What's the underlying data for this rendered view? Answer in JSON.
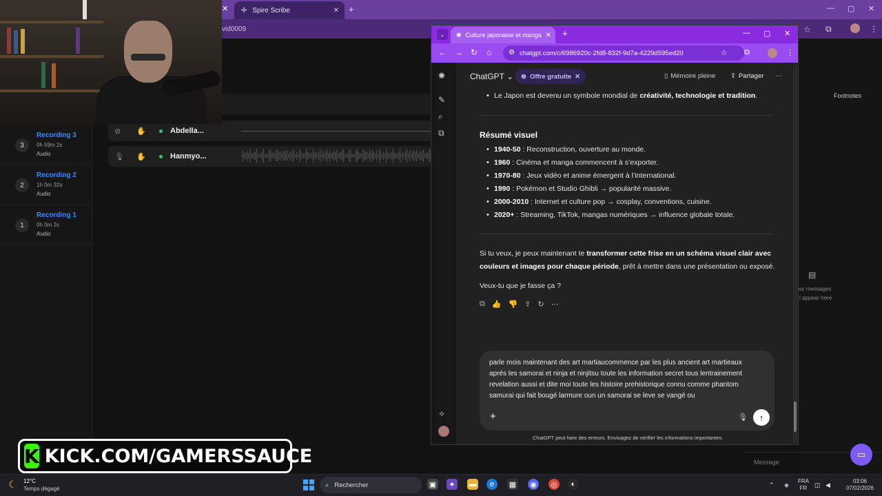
{
  "background_browser": {
    "tab_title": "Spire Scribe",
    "address_fragment": "vid0009"
  },
  "scribe": {
    "recordings": [
      {
        "num": "3",
        "title": "Recording 3",
        "duration": "0h 59m 2s",
        "type": "Audio"
      },
      {
        "num": "2",
        "title": "Recording 2",
        "duration": "1h 0m 32s",
        "type": "Audio"
      },
      {
        "num": "1",
        "title": "Recording 1",
        "duration": "0h 0m 2s",
        "type": "Audio"
      }
    ],
    "tracks": [
      {
        "name": "Abdella..."
      },
      {
        "name": "Hanmyo..."
      }
    ],
    "right_panel": {
      "footnotes": "Footnotes",
      "hint_line1": "our messages",
      "hint_line2": "l appear here",
      "message_placeholder": "Message"
    }
  },
  "chrome": {
    "tab_title": "Culture japonaise et manga",
    "url": "chatgpt.com/c/6986920c-2fd8-832f-9d7a-4229d595ed20"
  },
  "chatgpt": {
    "model": "ChatGPT",
    "offer": "Offre gratuite",
    "memory": "Mémoire pleine",
    "share": "Partager",
    "intro_bullet_prefix": "Le Japon est devenu un symbole mondial de ",
    "intro_bullet_bold": "créativité, technologie et tradition",
    "intro_bullet_suffix": ".",
    "section_title": "Résumé visuel",
    "timeline": [
      {
        "period": "1940-50",
        "text": " : Reconstruction, ouverture au monde."
      },
      {
        "period": "1960",
        "text": " : Cinéma et manga commencent à s’exporter."
      },
      {
        "period": "1970-80",
        "text": " : Jeux vidéo et anime émergent à l’international."
      },
      {
        "period": "1990",
        "text": " : Pokémon et Studio Ghibli → popularité massive."
      },
      {
        "period": "2000-2010",
        "text": " : Internet et culture pop → cosplay, conventions, cuisine."
      },
      {
        "period": "2020+",
        "text": " : Streaming, TikTok, mangas numériques → influence globale totale."
      }
    ],
    "offer_para": {
      "prefix": "Si tu veux, je peux maintenant te ",
      "bold_line1": "transformer cette frise en un schéma visuel clair avec",
      "bold_line2": "couleurs et images pour chaque période",
      "suffix": ", prêt à mettre dans une présentation ou exposé."
    },
    "question": "Veux-tu que je fasse ça ?",
    "composer_lines": [
      "parle mois maintenant des art martiaucommence par les plus ancient art martieaux",
      "aprés les  samorai et ninja et ninjitsu  toute les information secret tous lentrainement",
      "revelation  aussi et dite moi toute les histoire prehistorique connu comme phantom",
      "samurai qui fait bougé larmure oun un samorai se leve se vangé ou"
    ],
    "disclaimer": "ChatGPT peut faire des erreurs. Envisagez de vérifier les informations importantes."
  },
  "overlay": {
    "kick_text": "KICK.COM/GAMERSSAUCE"
  },
  "taskbar": {
    "temp": "12°C",
    "weather": "Temps dégagé",
    "search": "Rechercher",
    "lang1": "FRA",
    "lang2": "FR",
    "time": "03:06",
    "date": "07/02/2026"
  }
}
